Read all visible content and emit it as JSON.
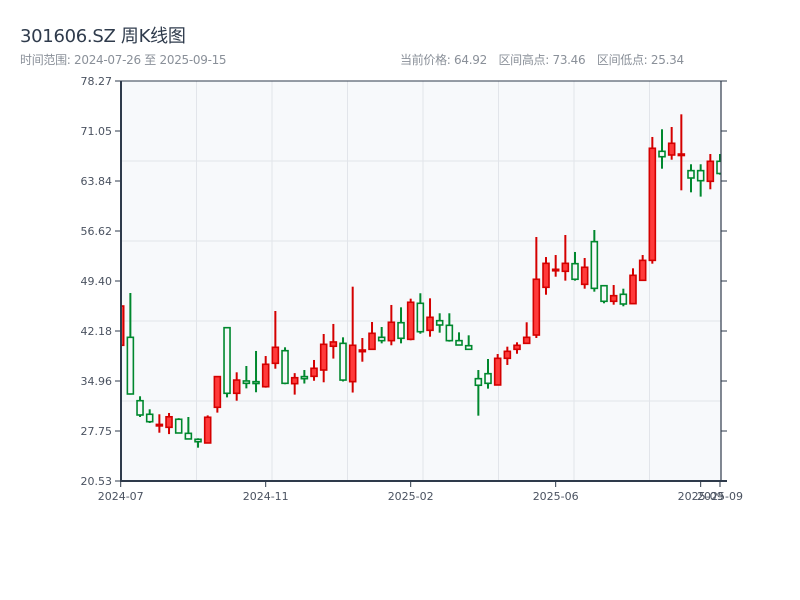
{
  "header": {
    "title": "301606.SZ 周K线图",
    "range_text": "时间范围: 2024-07-26 至 2025-09-15",
    "current_price": "当前价格: 64.92",
    "range_high": "区间高点: 73.46",
    "range_low": "区间低点: 25.34"
  },
  "colors": {
    "up_fill": "#ff3b3b",
    "up_stroke": "#d40000",
    "down_stroke": "#00882e",
    "plot_bg": "#f7f9fb",
    "axis": "#2e3a4b",
    "grid": "#e2e5ea"
  },
  "chart_data": {
    "type": "candlestick",
    "title": "301606.SZ 周K线图",
    "ylim": [
      20.53,
      78.27
    ],
    "yticks": [
      "78.27",
      "71.05",
      "63.84",
      "56.62",
      "49.40",
      "42.18",
      "34.96",
      "27.75",
      "20.53"
    ],
    "xticks": [
      {
        "index": 0,
        "label": "2024-07"
      },
      {
        "index": 15,
        "label": "2024-11"
      },
      {
        "index": 30,
        "label": "2025-02"
      },
      {
        "index": 45,
        "label": "2025-06"
      },
      {
        "index": 60,
        "label": "2025-09"
      },
      {
        "index": 62,
        "label": "2025-09"
      }
    ],
    "grid": true,
    "up_style": "red filled",
    "down_style": "green hollow",
    "ohlc_fields": [
      "open",
      "high",
      "low",
      "close"
    ],
    "candles": [
      [
        40.12,
        45.79,
        40.12,
        45.79
      ],
      [
        41.27,
        47.67,
        33.0,
        33.09
      ],
      [
        32.12,
        32.76,
        29.77,
        30.06
      ],
      [
        30.16,
        30.88,
        28.9,
        29.09
      ],
      [
        28.5,
        30.16,
        27.5,
        28.7
      ],
      [
        28.28,
        30.35,
        27.3,
        29.8
      ],
      [
        29.44,
        29.6,
        27.4,
        27.46
      ],
      [
        27.41,
        29.77,
        26.6,
        26.6
      ],
      [
        26.55,
        26.7,
        25.34,
        26.2
      ],
      [
        26.02,
        30.0,
        26.02,
        29.73
      ],
      [
        31.17,
        35.6,
        30.4,
        35.6
      ],
      [
        42.66,
        42.7,
        32.6,
        33.19
      ],
      [
        33.19,
        36.22,
        32.12,
        35.1
      ],
      [
        34.97,
        37.13,
        33.9,
        34.63
      ],
      [
        34.87,
        39.3,
        33.34,
        34.6
      ],
      [
        34.14,
        38.57,
        34.0,
        37.38
      ],
      [
        37.52,
        45.07,
        36.74,
        39.83
      ],
      [
        39.34,
        39.83,
        34.5,
        34.63
      ],
      [
        34.58,
        36.1,
        33.0,
        35.44
      ],
      [
        35.6,
        36.55,
        34.6,
        35.3
      ],
      [
        35.64,
        38.0,
        35.0,
        36.8
      ],
      [
        36.55,
        41.75,
        34.78,
        40.26
      ],
      [
        39.98,
        43.2,
        38.2,
        40.6
      ],
      [
        40.4,
        41.27,
        34.9,
        35.1
      ],
      [
        34.87,
        48.58,
        33.3,
        40.12
      ],
      [
        39.2,
        41.17,
        37.75,
        39.44
      ],
      [
        39.54,
        43.48,
        39.54,
        41.85
      ],
      [
        41.27,
        42.76,
        40.4,
        40.79
      ],
      [
        40.79,
        45.94,
        40.12,
        43.44
      ],
      [
        43.38,
        45.6,
        40.4,
        41.13
      ],
      [
        40.98,
        46.85,
        40.84,
        46.33
      ],
      [
        46.18,
        47.63,
        41.79,
        42.08
      ],
      [
        42.28,
        46.9,
        41.36,
        44.16
      ],
      [
        43.67,
        44.74,
        41.94,
        43.05
      ],
      [
        43.0,
        44.74,
        40.64,
        40.79
      ],
      [
        40.79,
        41.99,
        40.16,
        40.16
      ],
      [
        40.06,
        41.56,
        39.54,
        39.54
      ],
      [
        35.3,
        36.55,
        29.96,
        34.35
      ],
      [
        36.02,
        38.14,
        33.86,
        34.63
      ],
      [
        34.39,
        38.86,
        34.39,
        38.24
      ],
      [
        38.24,
        39.92,
        37.28,
        39.25
      ],
      [
        39.54,
        40.55,
        38.9,
        40.12
      ],
      [
        40.4,
        43.44,
        40.4,
        41.27
      ],
      [
        41.6,
        55.75,
        41.17,
        49.65
      ],
      [
        48.49,
        52.86,
        47.42,
        51.95
      ],
      [
        51.0,
        53.15,
        50.02,
        51.09
      ],
      [
        50.8,
        56.04,
        49.45,
        51.95
      ],
      [
        51.9,
        53.59,
        49.45,
        49.65
      ],
      [
        48.92,
        52.72,
        48.29,
        51.38
      ],
      [
        55.08,
        56.76,
        47.86,
        48.34
      ],
      [
        48.72,
        48.8,
        46.18,
        46.47
      ],
      [
        46.47,
        48.82,
        45.98,
        47.28
      ],
      [
        47.48,
        48.29,
        45.75,
        46.08
      ],
      [
        46.13,
        51.23,
        46.13,
        50.22
      ],
      [
        49.5,
        53.15,
        49.5,
        52.38
      ],
      [
        52.38,
        70.19,
        51.9,
        68.56
      ],
      [
        68.12,
        71.3,
        65.61,
        67.34
      ],
      [
        67.59,
        71.63,
        66.91,
        69.28
      ],
      [
        67.59,
        73.46,
        62.49,
        67.73
      ],
      [
        65.33,
        66.25,
        62.2,
        64.27
      ],
      [
        65.33,
        66.25,
        61.58,
        63.88
      ],
      [
        63.79,
        67.73,
        62.64,
        66.68
      ],
      [
        66.68,
        67.73,
        64.75,
        64.92
      ]
    ]
  }
}
